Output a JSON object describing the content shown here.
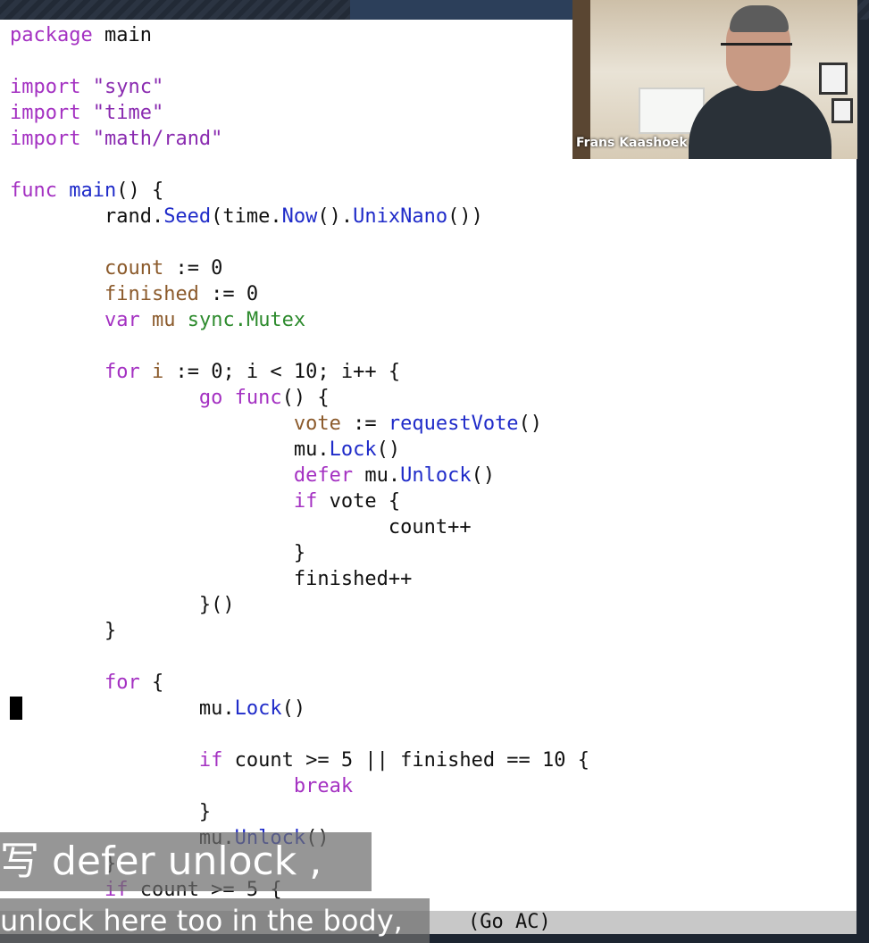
{
  "editor": {
    "lines": [
      [
        {
          "t": "package",
          "c": "kw"
        },
        {
          "t": " main"
        }
      ],
      [],
      [
        {
          "t": "import",
          "c": "kw"
        },
        {
          "t": " \"sync\"",
          "c": "str"
        }
      ],
      [
        {
          "t": "import",
          "c": "kw"
        },
        {
          "t": " \"time\"",
          "c": "str"
        }
      ],
      [
        {
          "t": "import",
          "c": "kw"
        },
        {
          "t": " \"math/rand\"",
          "c": "str"
        }
      ],
      [],
      [
        {
          "t": "func",
          "c": "kw"
        },
        {
          "t": " "
        },
        {
          "t": "main",
          "c": "fn"
        },
        {
          "t": "() {"
        }
      ],
      [
        {
          "t": "        rand."
        },
        {
          "t": "Seed",
          "c": "fn"
        },
        {
          "t": "(time."
        },
        {
          "t": "Now",
          "c": "fn"
        },
        {
          "t": "()."
        },
        {
          "t": "UnixNano",
          "c": "fn"
        },
        {
          "t": "())"
        }
      ],
      [],
      [
        {
          "t": "        "
        },
        {
          "t": "count",
          "c": "var"
        },
        {
          "t": " := 0"
        }
      ],
      [
        {
          "t": "        "
        },
        {
          "t": "finished",
          "c": "var"
        },
        {
          "t": " := 0"
        }
      ],
      [
        {
          "t": "        "
        },
        {
          "t": "var",
          "c": "kw"
        },
        {
          "t": " "
        },
        {
          "t": "mu",
          "c": "var"
        },
        {
          "t": " "
        },
        {
          "t": "sync.Mutex",
          "c": "ty"
        }
      ],
      [],
      [
        {
          "t": "        "
        },
        {
          "t": "for",
          "c": "kw"
        },
        {
          "t": " "
        },
        {
          "t": "i",
          "c": "var"
        },
        {
          "t": " := 0; i < 10; i++ {"
        }
      ],
      [
        {
          "t": "                "
        },
        {
          "t": "go",
          "c": "kw"
        },
        {
          "t": " "
        },
        {
          "t": "func",
          "c": "kw"
        },
        {
          "t": "() {"
        }
      ],
      [
        {
          "t": "                        "
        },
        {
          "t": "vote",
          "c": "var"
        },
        {
          "t": " := "
        },
        {
          "t": "requestVote",
          "c": "fn"
        },
        {
          "t": "()"
        }
      ],
      [
        {
          "t": "                        mu."
        },
        {
          "t": "Lock",
          "c": "fn"
        },
        {
          "t": "()"
        }
      ],
      [
        {
          "t": "                        "
        },
        {
          "t": "defer",
          "c": "kw"
        },
        {
          "t": " mu."
        },
        {
          "t": "Unlock",
          "c": "fn"
        },
        {
          "t": "()"
        }
      ],
      [
        {
          "t": "                        "
        },
        {
          "t": "if",
          "c": "kw"
        },
        {
          "t": " vote {"
        }
      ],
      [
        {
          "t": "                                count++"
        }
      ],
      [
        {
          "t": "                        }"
        }
      ],
      [
        {
          "t": "                        finished++"
        }
      ],
      [
        {
          "t": "                }()"
        }
      ],
      [
        {
          "t": "        }"
        }
      ],
      [],
      [
        {
          "t": "        "
        },
        {
          "t": "for",
          "c": "kw"
        },
        {
          "t": " {"
        }
      ],
      [
        {
          "t": "                mu."
        },
        {
          "t": "Lock",
          "c": "fn"
        },
        {
          "t": "()"
        }
      ],
      [],
      [
        {
          "t": "                "
        },
        {
          "t": "if",
          "c": "kw"
        },
        {
          "t": " count >= 5 || finished == 10 {"
        }
      ],
      [
        {
          "t": "                        "
        },
        {
          "t": "break",
          "c": "kw"
        }
      ],
      [
        {
          "t": "                }"
        }
      ],
      [
        {
          "t": "                mu."
        },
        {
          "t": "Unlock",
          "c": "fn"
        },
        {
          "t": "()"
        }
      ],
      [
        {
          "t": "        }"
        }
      ],
      [
        {
          "t": "        "
        },
        {
          "t": "if",
          "c": "kw"
        },
        {
          "t": " count >= 5 {"
        }
      ]
    ]
  },
  "statusbar": {
    "mode": "(Go AC)"
  },
  "video": {
    "participant_name": "Frans Kaashoek"
  },
  "subtitles": {
    "line1": "写 defer unlock ,",
    "line2": "unlock here too in the body,"
  }
}
